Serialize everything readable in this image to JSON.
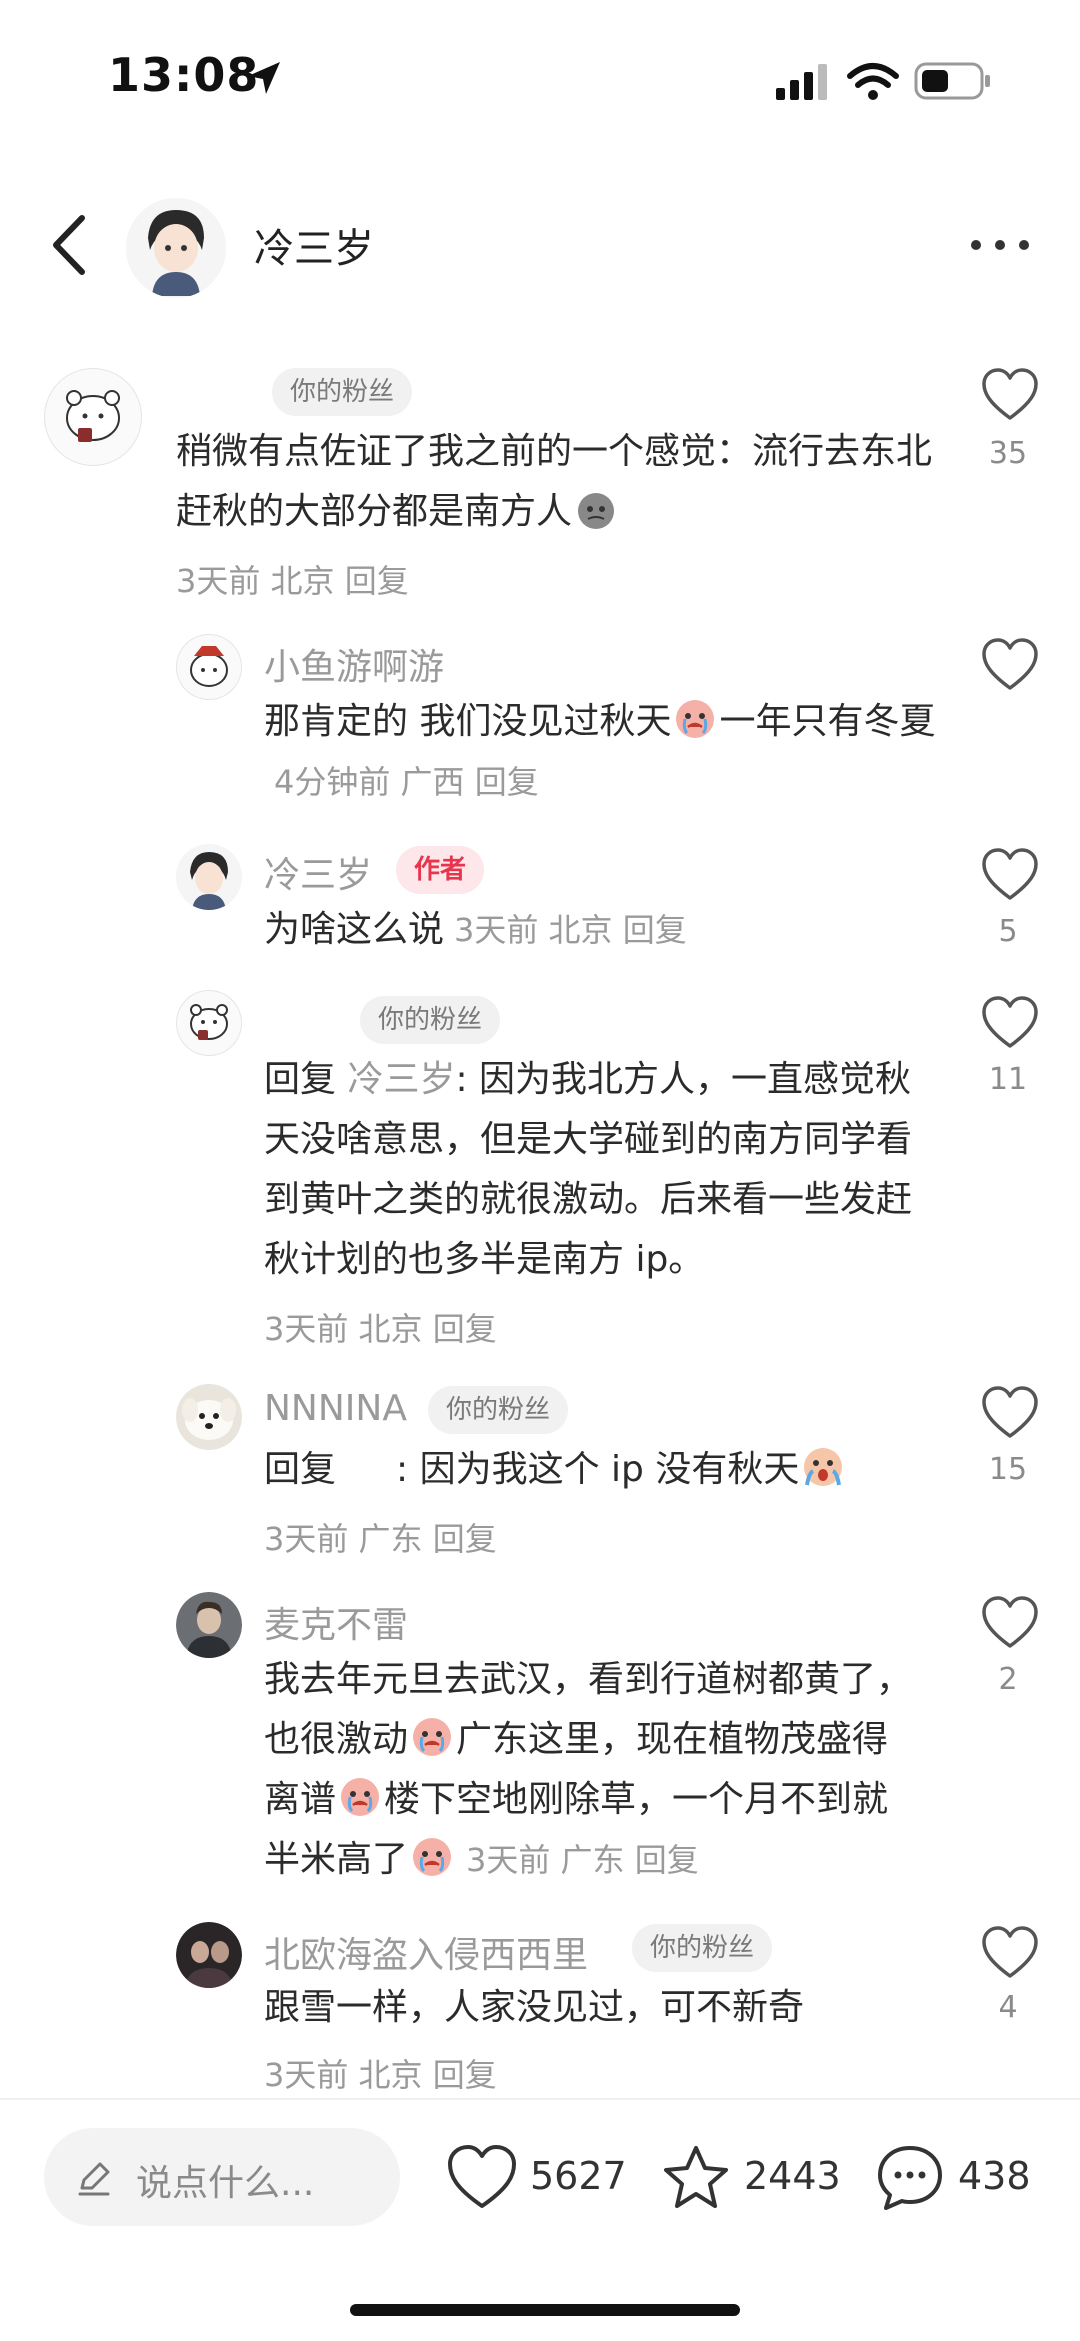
{
  "status": {
    "time": "13:08"
  },
  "header": {
    "title": "冷三岁"
  },
  "comments": [
    {
      "username": "",
      "badge": "你的粉丝",
      "text": "稍微有点佐证了我之前的一个感觉：流行去东北赶秋的大部分都是南方人",
      "meta": "3天前 北京 回复",
      "likes": "35"
    },
    {
      "username": "小鱼游啊游",
      "text_a": "那肯定的 我们没见过秋天",
      "text_b": "一年只有冬夏",
      "meta": "4分钟前 广西 回复",
      "likes": ""
    },
    {
      "username": "冷三岁",
      "badge": "作者",
      "text": "为啥这么说",
      "meta": "3天前 北京 回复",
      "likes": "5"
    },
    {
      "username": "",
      "badge": "你的粉丝",
      "reply_prefix": "回复 ",
      "reply_target": "冷三岁",
      "text": ": 因为我北方人，一直感觉秋天没啥意思，但是大学碰到的南方同学看到黄叶之类的就很激动。后来看一些发赶秋计划的也多半是南方 ip。",
      "meta": "3天前 北京 回复",
      "likes": "11"
    },
    {
      "username": "NNNINA",
      "badge": "你的粉丝",
      "reply_prefix": "回复",
      "text": ": 因为我这个 ip 没有秋天",
      "meta": "3天前 广东 回复",
      "likes": "15"
    },
    {
      "username": "麦克不雷",
      "text_a": "我去年元旦去武汉，看到行道树都黄了，也很激动",
      "text_b": "广东这里，现在植物茂盛得离谱",
      "text_c": "楼下空地刚除草，一个月不到就半米高了",
      "meta": "3天前 广东 回复",
      "likes": "2"
    },
    {
      "username": "北欧海盗入侵西西里",
      "badge": "你的粉丝",
      "text": "跟雪一样，人家没见过，可不新奇",
      "meta": "3天前 北京 回复",
      "likes": "4"
    }
  ],
  "bottom_bar": {
    "placeholder": "说点什么...",
    "likes": "5627",
    "favorites": "2443",
    "comments": "438"
  },
  "colors": {
    "author_badge": "#e8344d",
    "muted_text": "#9a9a9a"
  }
}
